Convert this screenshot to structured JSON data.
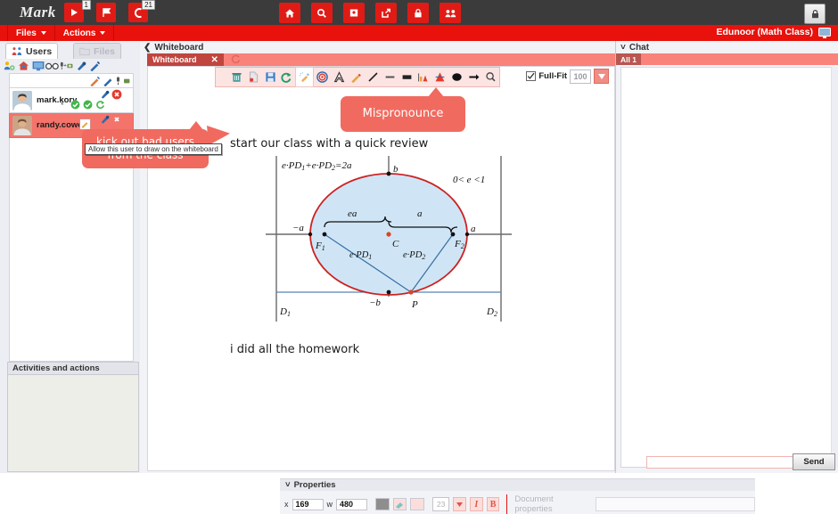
{
  "topbar": {
    "logo": "Mark",
    "buttons": [
      {
        "name": "play-button",
        "icon": "play-icon",
        "badge": "1"
      },
      {
        "name": "flag-button",
        "icon": "flag-icon",
        "badge": ""
      },
      {
        "name": "call-button",
        "icon": "phone-icon",
        "badge": "21"
      }
    ],
    "center_icons": [
      {
        "name": "home-button",
        "icon": "home-icon"
      },
      {
        "name": "search-button",
        "icon": "search-icon"
      },
      {
        "name": "board-button",
        "icon": "presentation-icon"
      },
      {
        "name": "share-button",
        "icon": "share-icon"
      },
      {
        "name": "lock-button",
        "icon": "lock-icon"
      },
      {
        "name": "users-button",
        "icon": "users-icon"
      }
    ],
    "lock_label": "lock-icon"
  },
  "menubar": {
    "files": "Files",
    "actions": "Actions",
    "room_title": "Edunoor (Math Class)"
  },
  "left": {
    "tab_users": "Users",
    "tab_files": "Files",
    "icon_strip": [
      "add-user-icon",
      "user-home-icon",
      "monitor-icon",
      "glasses-icon",
      "mic-camera-icon",
      "microphone-icon",
      "pencil-icon"
    ],
    "users": [
      {
        "name": "mark.kory",
        "status": "*",
        "row": "user-row-mark"
      },
      {
        "name": "randy.cowell",
        "status": "",
        "row": "user-row-randy"
      }
    ],
    "activities_title": "Activities and actions"
  },
  "whiteboard": {
    "breadcrumb": "Whiteboard",
    "tab_label": "Whiteboard",
    "tools": [
      "trash-icon",
      "new-document-icon",
      "save-icon",
      "undo-icon",
      "clean-icon",
      "target-icon",
      "text-icon",
      "pencil-icon",
      "line-icon",
      "minus-icon",
      "rectangle-icon",
      "chart-icon",
      "cone-icon",
      "ellipse-icon",
      "arrow-icon",
      "zoom-icon"
    ],
    "fullfit_label": "Full-Fit",
    "fullfit_checked": true,
    "zoom_value": "100",
    "text_top": "start our class with a quick review",
    "text_bottom": "i did all the homework"
  },
  "callouts": {
    "mispronounce": "Mispronounce",
    "kickout_line1": "kick out bad users",
    "kickout_line2": "from the class",
    "tooltip": "Allow this user to draw on the whiteboard"
  },
  "diagram": {
    "equation": "e·PD₁+e·PD₂=2a",
    "eccentricity": "0< e <1",
    "label_b": "b",
    "label_minus_b": "−b",
    "label_a": "a",
    "label_minus_a": "−a",
    "label_ea": "ea",
    "label_a_brace": "a",
    "label_C": "C",
    "label_F1": "F₁",
    "label_F2": "F₂",
    "label_P": "P",
    "label_D1": "D₁",
    "label_D2": "D₂",
    "label_ePD1": "e·PD₁",
    "label_ePD2": "e·PD₂",
    "ellipse_stroke": "#cc2222",
    "ellipse_fill": "#cfe5f5",
    "line_color": "#3a6ea5"
  },
  "properties": {
    "title": "Properties",
    "x_label": "x",
    "x_value": "169",
    "w_label": "w",
    "w_value": "480",
    "font_size": "23",
    "italic": "I",
    "bold": "B",
    "doc_props_label": "Document properties"
  },
  "chat": {
    "title": "Chat",
    "tab_all": "All 1",
    "send_label": "Send"
  },
  "colors": {
    "brand_red": "#e8110b",
    "dark_bar": "#3b3b3b",
    "accent_salmon": "#f16a5f",
    "panel_bg": "#eceef3"
  }
}
